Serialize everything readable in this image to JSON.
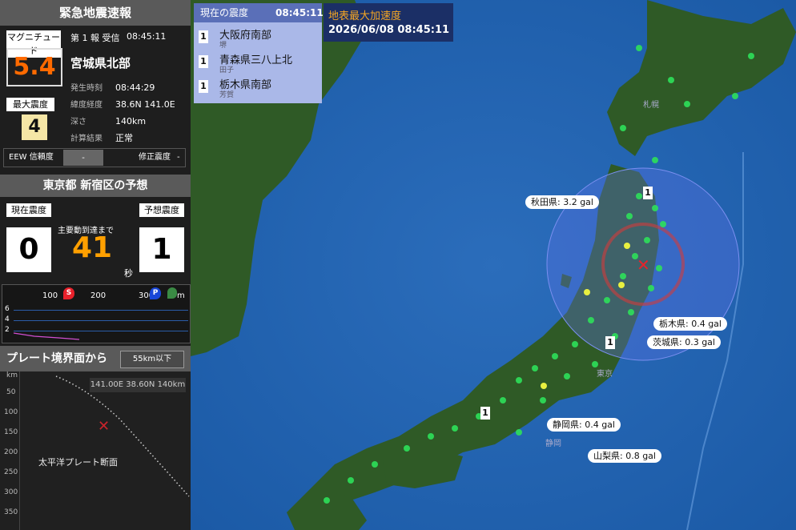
{
  "eew": {
    "title": "緊急地震速報",
    "mag_label": "マグニチュード",
    "report": "第 1 報 受信",
    "recv_time": "08:45:11",
    "magnitude": "5.4",
    "area": "宮城県北部",
    "maxint_label": "最大震度",
    "maxint": "4",
    "rows": [
      {
        "k": "発生時刻",
        "v": "08:44:29"
      },
      {
        "k": "緯度経度",
        "v": "38.6N 141.0E"
      },
      {
        "k": "深さ",
        "v": "140km"
      },
      {
        "k": "計算結果",
        "v": "正常"
      }
    ],
    "reliability_label": "EEW 信頼度",
    "reliability_value": "-",
    "corrected_label": "修正震度",
    "corrected_value": "-"
  },
  "forecast": {
    "title": "東京都 新宿区の予想",
    "current_label": "現在震度",
    "current": "0",
    "arrival_label": "主要動到達まで",
    "seconds": "41",
    "unit": "秒",
    "predicted_label": "予想震度",
    "predicted": "1"
  },
  "wave": {
    "ticks": [
      "100",
      "200",
      "300"
    ],
    "s_label": "S",
    "p_label": "P",
    "km_label": "m",
    "y_ticks": [
      "6",
      "4",
      "2"
    ]
  },
  "plate": {
    "title": "プレート境界面から",
    "depth_tag": "55km以下",
    "info": "141.00E 38.60N 140km",
    "km": "km",
    "y_ticks": [
      "50",
      "100",
      "150",
      "200",
      "250",
      "300",
      "350"
    ],
    "caption": "太平洋プレート断面"
  },
  "current_list": {
    "title": "現在の震度",
    "time": "08:45:11",
    "items": [
      {
        "int": "1",
        "name": "大阪府南部",
        "sub": "堺"
      },
      {
        "int": "1",
        "name": "青森県三八上北",
        "sub": "田子"
      },
      {
        "int": "1",
        "name": "栃木県南部",
        "sub": "芳賀"
      }
    ]
  },
  "pga": {
    "title": "地表最大加速度",
    "datetime": "2026/06/08 08:45:11"
  },
  "map_labels": {
    "akita": "秋田県: 3.2 gal",
    "tochigi": "栃木県: 0.4 gal",
    "ibaraki": "茨城県: 0.3 gal",
    "shizuoka": "静岡県: 0.4 gal",
    "yamanashi": "山梨県: 0.8 gal"
  },
  "markers": {
    "m1": "1",
    "m2": "1",
    "m3": "1"
  },
  "places": {
    "sapporo": "札幌",
    "tokyo": "東京",
    "shizuoka": "静岡"
  },
  "colors": {
    "mag": "#ff6a00",
    "seconds": "#ffa000",
    "sea": "#1d5ba8",
    "land": "#2f5a26",
    "station": "#2ee05a"
  }
}
